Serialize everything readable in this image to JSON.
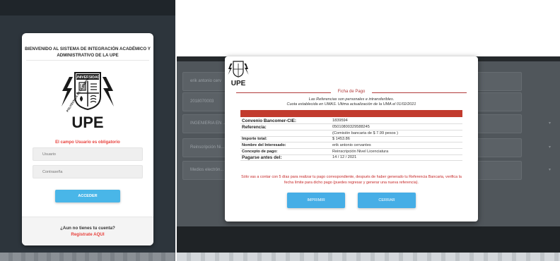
{
  "login": {
    "title": "BIENVENIDO AL SISTEMA DE INTEGRACIÓN ACADÉMICO Y ADMINISTRATIVO DE LA UPE",
    "logo": {
      "arc_text": "UNIVERSIDAD",
      "side_text": "POLITÉCNICA DE LA ENERGÍA",
      "wordmark": "UPE"
    },
    "error_message": "El campo Usuario es obligatorio",
    "username_placeholder": "Usuario",
    "password_placeholder": "Contraseña",
    "submit_label": "ACCEDER",
    "no_account_text": "¿Aun no tienes tu cuenta?",
    "register_link": "Registrate AQUI"
  },
  "background_form": {
    "fields": [
      {
        "value": "erik antonio cerv"
      },
      {
        "value": "2018070003"
      },
      {
        "value": "INGENIERIA EN ..."
      },
      {
        "value": "Reinscripción Ni..."
      },
      {
        "value": "Medios electrón..."
      }
    ]
  },
  "slip": {
    "logo_wordmark": "UPE",
    "legend": "Ficha de Pago",
    "note_line1": "Las Referencias son personales e intransferibles.",
    "note_line2": "Cuota establecida en UMAS. Ultima actualización de la UMA el 01/02/2021",
    "rows": [
      {
        "label": "Convenio Bancomer-CIE:",
        "value": "1839594"
      },
      {
        "label": "Referencia:",
        "value": "05010800329588245"
      },
      {
        "label": "",
        "value": "(Comisión bancaria de $ 7.99 pesos )"
      },
      {
        "label": "Importe total:",
        "value": "$ 1453.86"
      },
      {
        "label": "Nombre del Interesado:",
        "value": "erik antonio cervantes"
      },
      {
        "label": "Concepto de pago:",
        "value": "Reinscripción Nivel Licenciatura"
      },
      {
        "label": "Pagarse antes del:",
        "value": "14 / 12 / 2021"
      }
    ],
    "warning": "Sólo vas a contar con 5 días para realizar tu pago correspondiente, después de haber generado tu Referencia Bancaria, verifica la fecha límite para dicho pago (puedes regresar y generar una nueva referencia).",
    "print_label": "IMPRIMIR",
    "close_label": "CERRAR"
  },
  "colors": {
    "brand_red": "#c23b2e",
    "button_blue": "#46aee6",
    "error_red": "#e8413c",
    "dark_backdrop": "#2d353c"
  }
}
